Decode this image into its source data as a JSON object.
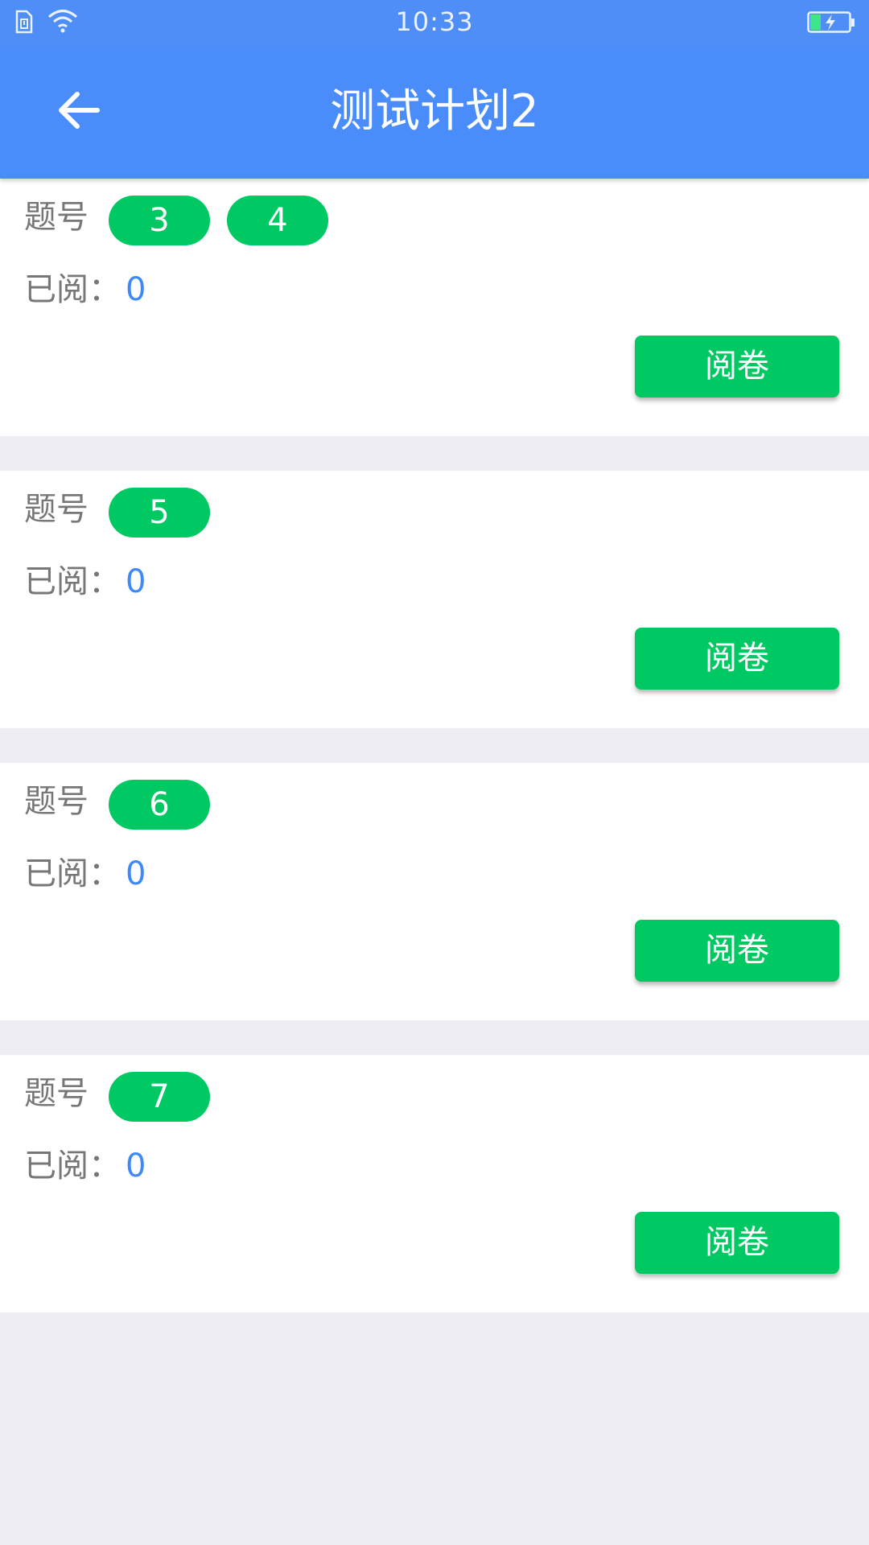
{
  "status_bar": {
    "time": "10:33",
    "icons": [
      "sim-card-icon",
      "wifi-icon",
      "battery-charging-icon"
    ]
  },
  "app_bar": {
    "title": "测试计划2",
    "back_icon": "arrow-left-icon"
  },
  "cards": [
    {
      "question_label": "题号",
      "questions": [
        "3",
        "4"
      ],
      "read_label": "已阅：",
      "read_count": "0",
      "button_label": "阅卷"
    },
    {
      "question_label": "题号",
      "questions": [
        "5"
      ],
      "read_label": "已阅：",
      "read_count": "0",
      "button_label": "阅卷"
    },
    {
      "question_label": "题号",
      "questions": [
        "6"
      ],
      "read_label": "已阅：",
      "read_count": "0",
      "button_label": "阅卷"
    },
    {
      "question_label": "题号",
      "questions": [
        "7"
      ],
      "read_label": "已阅：",
      "read_count": "0",
      "button_label": "阅卷"
    }
  ],
  "colors": {
    "status_bar": "#4F8DF7",
    "app_bar": "#4A8CFA",
    "accent_green": "#00C862",
    "count_blue": "#3D8AF7",
    "page_background": "#EDEDF3"
  }
}
